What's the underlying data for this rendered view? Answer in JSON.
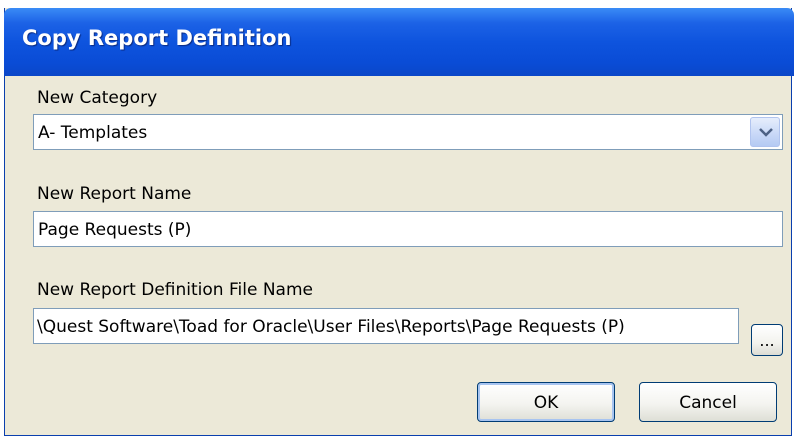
{
  "dialog": {
    "title": "Copy Report Definition",
    "new_category_label": "New Category",
    "new_category_value": "A- Templates",
    "new_report_name_label": "New Report Name",
    "new_report_name_value": "Page Requests (P)",
    "new_file_name_label": "New Report Definition File Name",
    "new_file_name_value": "\\Quest Software\\Toad for Oracle\\User Files\\Reports\\Page Requests (P)",
    "browse_label": "...",
    "ok_label": "OK",
    "cancel_label": "Cancel"
  },
  "colors": {
    "titlebar": "#0a4cd6",
    "dialog_background": "#ece9d8",
    "field_border": "#7f9db9"
  },
  "icons": {
    "dropdown": "chevron-down-icon"
  }
}
